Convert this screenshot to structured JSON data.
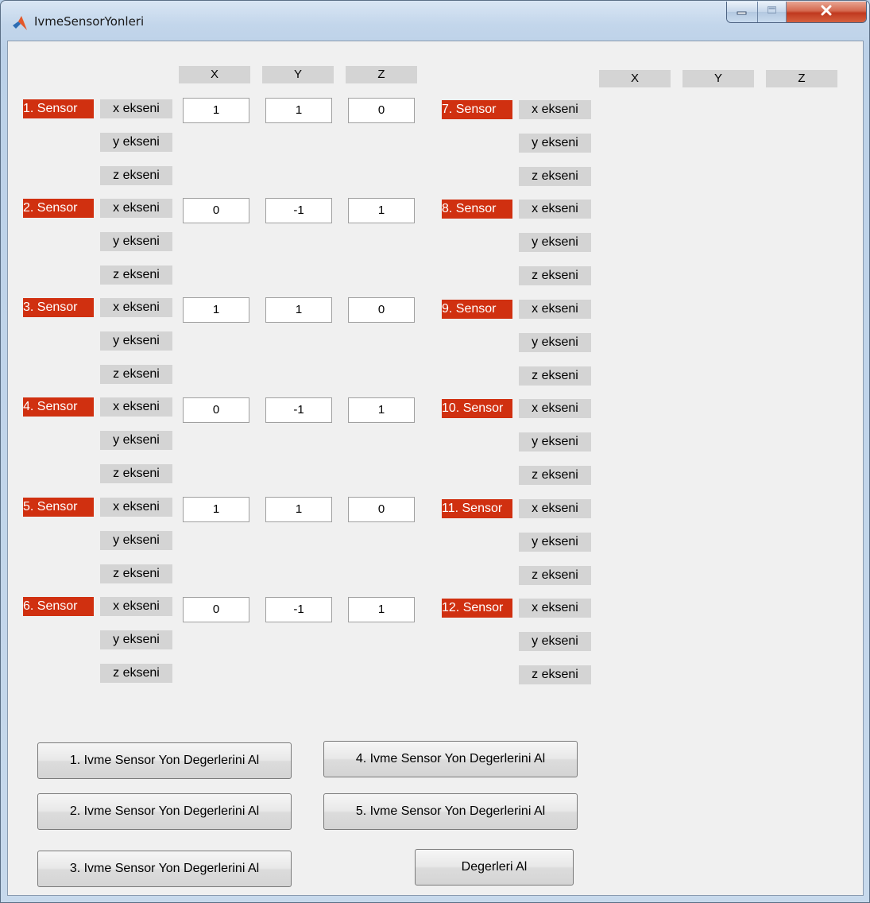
{
  "window": {
    "title": "IvmeSensorYonleri"
  },
  "left_headers": [
    "X",
    "Y",
    "Z"
  ],
  "right_headers": [
    "X",
    "Y",
    "Z"
  ],
  "axis_labels": {
    "x": "x ekseni",
    "y": "y ekseni",
    "z": "z ekseni"
  },
  "left_sensors": [
    {
      "label": "1. Sensor",
      "values": [
        "1",
        "1",
        "0"
      ]
    },
    {
      "label": "2. Sensor",
      "values": [
        "0",
        "-1",
        "1"
      ]
    },
    {
      "label": "3. Sensor",
      "values": [
        "1",
        "1",
        "0"
      ]
    },
    {
      "label": "4. Sensor",
      "values": [
        "0",
        "-1",
        "1"
      ]
    },
    {
      "label": "5. Sensor",
      "values": [
        "1",
        "1",
        "0"
      ]
    },
    {
      "label": "6. Sensor",
      "values": [
        "0",
        "-1",
        "1"
      ]
    }
  ],
  "right_sensors": [
    {
      "label": "7. Sensor"
    },
    {
      "label": "8. Sensor"
    },
    {
      "label": "9. Sensor"
    },
    {
      "label": "10. Sensor"
    },
    {
      "label": "11. Sensor"
    },
    {
      "label": "12. Sensor"
    }
  ],
  "buttons": {
    "get1": "1. Ivme Sensor Yon Degerlerini Al",
    "get2": "2. Ivme Sensor Yon Degerlerini Al",
    "get3": "3. Ivme Sensor Yon Degerlerini Al",
    "get4": "4. Ivme Sensor Yon Degerlerini Al",
    "get5": "5. Ivme Sensor Yon Degerlerini Al",
    "get_all": "Degerleri Al"
  },
  "colors": {
    "sensor_label_bg": "#d03010",
    "label_bg": "#d4d4d4",
    "panel_bg": "#f0f0f0"
  },
  "icons": {
    "app": "matlab-icon",
    "minimize": "minimize-icon",
    "maximize": "maximize-icon",
    "close": "close-icon"
  }
}
